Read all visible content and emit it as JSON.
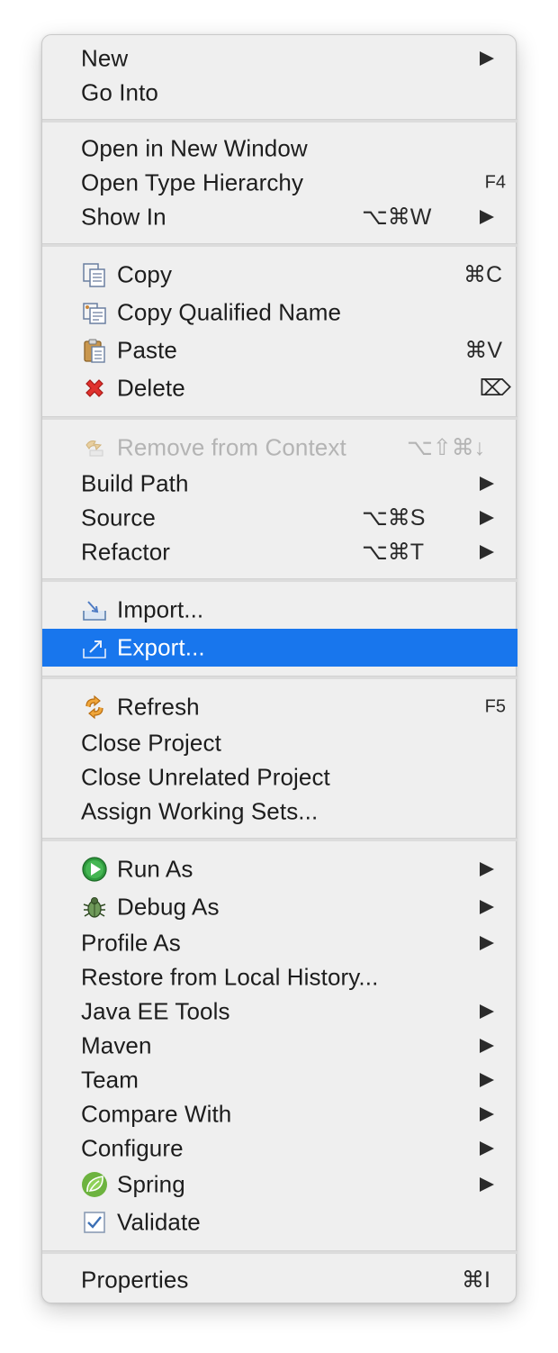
{
  "menu": {
    "accent_color": "#1876ed",
    "items": {
      "new": {
        "label": "New"
      },
      "go_into": {
        "label": "Go Into"
      },
      "open_new_window": {
        "label": "Open in New Window"
      },
      "open_type_hierarchy": {
        "label": "Open Type Hierarchy",
        "shortcut": "F4"
      },
      "show_in": {
        "label": "Show In",
        "shortcut": "⌥⌘W"
      },
      "copy": {
        "label": "Copy",
        "shortcut": "⌘C",
        "icon": "copy-icon"
      },
      "copy_qualified_name": {
        "label": "Copy Qualified Name",
        "icon": "copy-qualified-name-icon"
      },
      "paste": {
        "label": "Paste",
        "shortcut": "⌘V",
        "icon": "paste-icon"
      },
      "delete": {
        "label": "Delete",
        "shortcut": "⌦",
        "icon": "delete-icon"
      },
      "remove_from_context": {
        "label": "Remove from Context",
        "shortcut": "⌥⇧⌘↓",
        "icon": "remove-from-context-icon",
        "enabled": false
      },
      "build_path": {
        "label": "Build Path"
      },
      "source": {
        "label": "Source",
        "shortcut": "⌥⌘S"
      },
      "refactor": {
        "label": "Refactor",
        "shortcut": "⌥⌘T"
      },
      "import": {
        "label": "Import...",
        "icon": "import-icon"
      },
      "export": {
        "label": "Export...",
        "icon": "export-icon",
        "selected": true
      },
      "refresh": {
        "label": "Refresh",
        "shortcut": "F5",
        "icon": "refresh-icon"
      },
      "close_project": {
        "label": "Close Project"
      },
      "close_unrelated_project": {
        "label": "Close Unrelated Project"
      },
      "assign_working_sets": {
        "label": "Assign Working Sets..."
      },
      "run_as": {
        "label": "Run As",
        "icon": "run-icon"
      },
      "debug_as": {
        "label": "Debug As",
        "icon": "debug-bug-icon"
      },
      "profile_as": {
        "label": "Profile As"
      },
      "restore_local_history": {
        "label": "Restore from Local History..."
      },
      "java_ee_tools": {
        "label": "Java EE Tools"
      },
      "maven": {
        "label": "Maven"
      },
      "team": {
        "label": "Team"
      },
      "compare_with": {
        "label": "Compare With"
      },
      "configure": {
        "label": "Configure"
      },
      "spring": {
        "label": "Spring",
        "icon": "spring-leaf-icon"
      },
      "validate": {
        "label": "Validate",
        "icon": "validate-checkbox-icon"
      },
      "properties": {
        "label": "Properties",
        "shortcut": "⌘I"
      }
    }
  }
}
